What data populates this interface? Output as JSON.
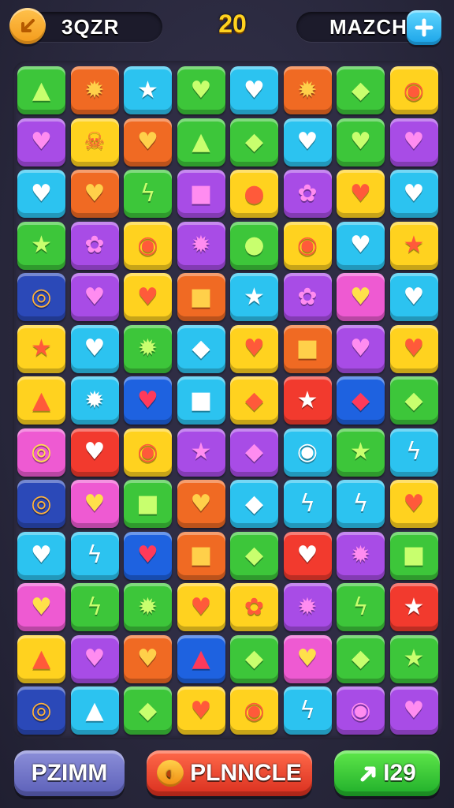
{
  "header": {
    "back_icon": "arrow-icon",
    "left_label": "3QZR",
    "score": "20",
    "right_label": "MAZCH",
    "plus_icon": "plus-icon"
  },
  "colors": {
    "green": "#3dc63a",
    "orange": "#f06a23",
    "cyan": "#2cc3f0",
    "purple": "#a84ce6",
    "yellow": "#ffd21f",
    "red": "#f23a2e",
    "blue": "#1e62e0",
    "pink": "#ee5ad2",
    "navy": "#2b49b8",
    "gray": "#bdbdc6"
  },
  "board": {
    "columns": 8,
    "rows": 13,
    "tiles": [
      [
        "green:bell-icon",
        "orange:splat-icon",
        "cyan:star-icon",
        "green:heart-icon",
        "cyan:heart-icon",
        "orange:splat-icon",
        "green:leaf-icon",
        "yellow:ring-icon"
      ],
      [
        "purple:heart-icon",
        "yellow:skull-icon",
        "orange:heart-icon",
        "green:bell-icon",
        "green:leaf-icon",
        "cyan:heart-icon",
        "green:heart-icon",
        "purple:heart-icon"
      ],
      [
        "cyan:heart-icon",
        "orange:heart-icon",
        "green:bolt-icon",
        "purple:square-icon",
        "yellow:apple-icon",
        "purple:flower-icon",
        "yellow:heart-icon",
        "cyan:heart-icon"
      ],
      [
        "green:star-icon",
        "purple:flower-icon",
        "yellow:ring-icon",
        "purple:splat-icon",
        "green:apple-icon",
        "yellow:ring-icon",
        "cyan:heart-icon",
        "yellow:star-icon"
      ],
      [
        "navy:eye-icon",
        "purple:heart-icon",
        "yellow:heart-icon",
        "orange:square-icon",
        "cyan:star-icon",
        "purple:flower-icon",
        "pink:heart-icon",
        "cyan:heart-icon"
      ],
      [
        "yellow:star-icon",
        "cyan:heart-icon",
        "green:splat-icon",
        "cyan:leaf-icon",
        "yellow:heart-icon",
        "orange:square-icon",
        "purple:heart-icon",
        "yellow:heart-icon"
      ],
      [
        "yellow:bell-icon",
        "cyan:splat-icon",
        "blue:heart-icon",
        "cyan:square-icon",
        "yellow:leaf-icon",
        "red:star-icon",
        "blue:leaf-icon",
        "green:leaf-icon"
      ],
      [
        "pink:eye-icon",
        "red:heart-icon",
        "yellow:ring-icon",
        "purple:star-icon",
        "purple:leaf-icon",
        "cyan:ring-icon",
        "green:star-icon",
        "cyan:bolt-icon"
      ],
      [
        "navy:eye-icon",
        "pink:heart-icon",
        "green:square-icon",
        "orange:heart-icon",
        "cyan:leaf-icon",
        "cyan:bolt-icon",
        "cyan:bolt-icon",
        "yellow:heart-icon"
      ],
      [
        "cyan:heart-icon",
        "cyan:bolt-icon",
        "blue:heart-icon",
        "orange:square-icon",
        "green:leaf-icon",
        "red:heart-icon",
        "purple:splat-icon",
        "green:square-icon"
      ],
      [
        "pink:heart-icon",
        "green:bolt-icon",
        "green:splat-icon",
        "yellow:heart-icon",
        "yellow:flower-icon",
        "purple:splat-icon",
        "green:bolt-icon",
        "red:star-icon"
      ],
      [
        "yellow:bell-icon",
        "purple:heart-icon",
        "orange:heart-icon",
        "blue:bell-icon",
        "green:leaf-icon",
        "pink:heart-icon",
        "green:leaf-icon",
        "green:star-icon"
      ],
      [
        "navy:eye-icon",
        "cyan:bell-icon",
        "green:leaf-icon",
        "yellow:heart-icon",
        "yellow:ring-icon",
        "cyan:bolt-icon",
        "purple:ring-icon",
        "purple:heart-icon"
      ]
    ]
  },
  "glyphs": {
    "bell-icon": "▲",
    "splat-icon": "✹",
    "star-icon": "★",
    "heart-icon": "♥",
    "leaf-icon": "◆",
    "ring-icon": "◉",
    "skull-icon": "☠",
    "bolt-icon": "ϟ",
    "square-icon": "■",
    "apple-icon": "●",
    "flower-icon": "✿",
    "eye-icon": "◎"
  },
  "buttons": {
    "left_label": "PZIMM",
    "middle_label": "PLNNCLE",
    "middle_icon": "swirl-icon",
    "right_label": "I29",
    "right_icon": "arrow-icon"
  }
}
